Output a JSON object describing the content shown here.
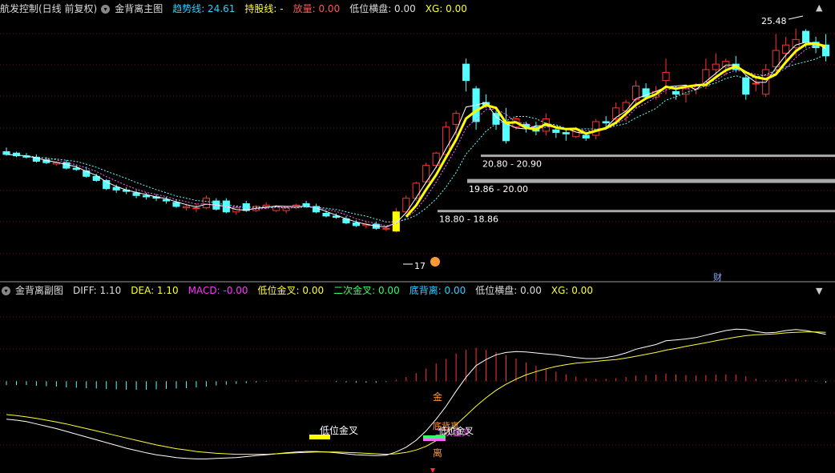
{
  "main_header": {
    "control_label": "航发控制(日线 前复权)",
    "indicator_name": "金背离主图",
    "items": [
      {
        "label": "趋势线: 24.61",
        "color": "#33ccff"
      },
      {
        "label": "持股线: -",
        "color": "#ffff33"
      },
      {
        "label": "放量: 0.00",
        "color": "#ff5555"
      },
      {
        "label": "低位横盘: 0.00",
        "color": "#dddddd"
      },
      {
        "label": "XG: 0.00",
        "color": "#ffff33"
      }
    ]
  },
  "sub_header": {
    "indicator_name": "金背离副图",
    "items": [
      {
        "label": "DIFF: 1.10",
        "color": "#dddddd"
      },
      {
        "label": "DEA: 1.10",
        "color": "#ffff33"
      },
      {
        "label": "MACD: -0.00",
        "color": "#ff33ff"
      },
      {
        "label": "低位金叉: 0.00",
        "color": "#ffff33"
      },
      {
        "label": "二次金叉: 0.00",
        "color": "#33ff66"
      },
      {
        "label": "底背离: 0.00",
        "color": "#33ccff"
      },
      {
        "label": "低位横盘: 0.00",
        "color": "#dddddd"
      },
      {
        "label": "XG: 0.00",
        "color": "#ffff33"
      }
    ]
  },
  "corner_icons": {
    "up": "▲",
    "down": "▼"
  },
  "annotations": {
    "high_label": "25.48",
    "low_label": "17",
    "cai_label": "财",
    "zones": [
      {
        "label": "20.80 - 20.90",
        "price": 20.85
      },
      {
        "label": "19.86 - 20.00",
        "price": 19.93
      },
      {
        "label": "18.80 - 18.86",
        "price": 18.83
      }
    ],
    "sub_labels": {
      "golden_cross": "低位金叉",
      "jin": "金",
      "stacked_a": "底背离",
      "stacked_b": "二次金叉",
      "stacked_c": "低位金叉",
      "li": "离"
    }
  },
  "colors": {
    "up": "#ff3333",
    "down": "#54ffff",
    "trend": "#ffff00",
    "ma": "#ffffff",
    "grid": "#6b1414",
    "diff": "#ffffff",
    "dea": "#ffff33"
  },
  "chart_data": {
    "type": "candlestick",
    "price_range": [
      16.6,
      25.9
    ],
    "candles": [
      [
        21.0,
        21.15,
        20.85,
        20.9
      ],
      [
        20.95,
        21.0,
        20.8,
        20.85
      ],
      [
        20.85,
        20.95,
        20.75,
        20.8
      ],
      [
        20.8,
        20.9,
        20.6,
        20.65
      ],
      [
        20.7,
        20.8,
        20.55,
        20.6
      ],
      [
        20.55,
        20.65,
        20.5,
        20.6
      ],
      [
        20.6,
        20.7,
        20.35,
        20.4
      ],
      [
        20.4,
        20.5,
        20.3,
        20.35
      ],
      [
        20.3,
        20.45,
        20.05,
        20.1
      ],
      [
        20.1,
        20.2,
        19.9,
        19.95
      ],
      [
        19.95,
        20.0,
        19.6,
        19.65
      ],
      [
        19.7,
        19.8,
        19.5,
        19.6
      ],
      [
        19.6,
        19.7,
        19.45,
        19.55
      ],
      [
        19.5,
        19.6,
        19.3,
        19.4
      ],
      [
        19.4,
        19.5,
        19.25,
        19.35
      ],
      [
        19.35,
        19.45,
        19.2,
        19.3
      ],
      [
        19.25,
        19.35,
        19.1,
        19.2
      ],
      [
        19.15,
        19.25,
        18.95,
        19.0
      ],
      [
        18.95,
        19.1,
        18.85,
        19.0
      ],
      [
        18.95,
        19.1,
        18.8,
        18.95
      ],
      [
        18.95,
        19.4,
        18.9,
        19.3
      ],
      [
        19.2,
        19.3,
        18.85,
        18.9
      ],
      [
        19.2,
        19.3,
        18.75,
        18.8
      ],
      [
        18.8,
        18.95,
        18.7,
        18.95
      ],
      [
        19.1,
        19.2,
        18.8,
        18.85
      ],
      [
        18.85,
        19.05,
        18.8,
        19.0
      ],
      [
        19.0,
        19.15,
        18.9,
        19.05
      ],
      [
        18.85,
        19.05,
        18.8,
        19.0
      ],
      [
        18.85,
        19.0,
        18.75,
        18.95
      ],
      [
        18.95,
        19.1,
        18.9,
        19.05
      ],
      [
        19.1,
        19.2,
        18.95,
        19.0
      ],
      [
        19.0,
        19.1,
        18.75,
        18.8
      ],
      [
        18.75,
        18.85,
        18.6,
        18.65
      ],
      [
        18.65,
        18.75,
        18.55,
        18.6
      ],
      [
        18.55,
        18.65,
        18.35,
        18.4
      ],
      [
        18.4,
        18.5,
        18.25,
        18.3
      ],
      [
        18.3,
        18.45,
        18.2,
        18.35
      ],
      [
        18.35,
        18.45,
        18.15,
        18.2
      ],
      [
        18.2,
        18.3,
        18.1,
        18.2
      ],
      [
        18.1,
        18.95,
        18.05,
        18.8
      ],
      [
        18.8,
        19.4,
        18.75,
        19.3
      ],
      [
        19.3,
        19.9,
        19.2,
        19.85
      ],
      [
        19.9,
        20.6,
        19.85,
        20.5
      ],
      [
        20.5,
        21.0,
        20.4,
        20.95
      ],
      [
        20.9,
        22.1,
        20.8,
        21.9
      ],
      [
        22.0,
        22.5,
        21.6,
        22.4
      ],
      [
        24.2,
        24.4,
        23.2,
        23.6
      ],
      [
        23.3,
        23.4,
        21.8,
        22.1
      ],
      [
        22.8,
        23.1,
        22.6,
        22.7
      ],
      [
        22.4,
        22.5,
        21.8,
        22.0
      ],
      [
        22.1,
        22.6,
        21.3,
        21.4
      ],
      [
        21.9,
        22.3,
        21.8,
        22.2
      ],
      [
        22.0,
        22.1,
        21.7,
        21.9
      ],
      [
        21.9,
        22.1,
        21.6,
        21.75
      ],
      [
        21.75,
        22.4,
        21.6,
        22.2
      ],
      [
        21.8,
        21.9,
        21.5,
        21.7
      ],
      [
        21.7,
        21.8,
        21.4,
        21.65
      ],
      [
        21.55,
        21.9,
        21.5,
        21.8
      ],
      [
        21.6,
        21.7,
        21.4,
        21.5
      ],
      [
        21.6,
        22.2,
        21.45,
        22.1
      ],
      [
        22.1,
        22.3,
        21.8,
        22.05
      ],
      [
        22.2,
        22.8,
        22.0,
        22.6
      ],
      [
        22.5,
        22.9,
        22.1,
        22.8
      ],
      [
        22.9,
        23.6,
        22.6,
        23.4
      ],
      [
        23.3,
        23.5,
        22.9,
        23.0
      ],
      [
        23.0,
        23.4,
        22.9,
        23.2
      ],
      [
        23.6,
        24.4,
        23.1,
        23.9
      ],
      [
        23.2,
        23.4,
        22.9,
        23.1
      ],
      [
        23.1,
        23.4,
        22.8,
        23.3
      ],
      [
        23.3,
        23.5,
        23.1,
        23.4
      ],
      [
        23.4,
        24.4,
        23.3,
        24.0
      ],
      [
        24.0,
        24.6,
        23.8,
        24.2
      ],
      [
        24.1,
        24.4,
        23.8,
        24.3
      ],
      [
        24.2,
        24.5,
        23.9,
        24.0
      ],
      [
        23.7,
        23.8,
        22.9,
        23.1
      ],
      [
        23.5,
        23.7,
        23.2,
        23.5
      ],
      [
        23.1,
        24.2,
        23.0,
        24.0
      ],
      [
        24.1,
        25.3,
        23.9,
        24.7
      ],
      [
        24.6,
        25.2,
        24.3,
        24.9
      ],
      [
        24.8,
        25.5,
        24.5,
        25.1
      ],
      [
        25.4,
        25.48,
        24.8,
        25.0
      ],
      [
        25.0,
        25.2,
        24.6,
        24.8
      ],
      [
        24.9,
        25.3,
        24.3,
        24.5
      ]
    ],
    "macd": {
      "diff": [
        -0.3,
        -0.32,
        -0.35,
        -0.4,
        -0.45,
        -0.5,
        -0.56,
        -0.62,
        -0.68,
        -0.74,
        -0.8,
        -0.86,
        -0.92,
        -0.97,
        -1.02,
        -1.06,
        -1.09,
        -1.12,
        -1.14,
        -1.15,
        -1.15,
        -1.14,
        -1.13,
        -1.12,
        -1.1,
        -1.08,
        -1.06,
        -1.04,
        -1.02,
        -1.0,
        -0.99,
        -0.99,
        -1.0,
        -1.02,
        -1.04,
        -1.06,
        -1.07,
        -1.08,
        -1.07,
        -1.0,
        -0.9,
        -0.75,
        -0.55,
        -0.3,
        -0.02,
        0.3,
        0.6,
        0.85,
        0.98,
        1.08,
        1.13,
        1.15,
        1.14,
        1.12,
        1.1,
        1.08,
        1.05,
        1.02,
        1.0,
        1.0,
        1.02,
        1.06,
        1.12,
        1.2,
        1.25,
        1.3,
        1.38,
        1.4,
        1.42,
        1.45,
        1.5,
        1.55,
        1.6,
        1.63,
        1.62,
        1.58,
        1.55,
        1.56,
        1.6,
        1.62,
        1.6,
        1.56,
        1.52
      ],
      "dea": [
        -0.2,
        -0.22,
        -0.25,
        -0.28,
        -0.32,
        -0.36,
        -0.4,
        -0.45,
        -0.5,
        -0.55,
        -0.6,
        -0.65,
        -0.7,
        -0.75,
        -0.8,
        -0.85,
        -0.89,
        -0.93,
        -0.96,
        -0.99,
        -1.01,
        -1.03,
        -1.04,
        -1.05,
        -1.05,
        -1.05,
        -1.05,
        -1.04,
        -1.03,
        -1.02,
        -1.01,
        -1.0,
        -1.0,
        -1.0,
        -1.01,
        -1.02,
        -1.03,
        -1.04,
        -1.05,
        -1.04,
        -1.01,
        -0.96,
        -0.88,
        -0.76,
        -0.6,
        -0.42,
        -0.22,
        -0.02,
        0.16,
        0.32,
        0.45,
        0.56,
        0.65,
        0.72,
        0.78,
        0.83,
        0.87,
        0.9,
        0.92,
        0.94,
        0.96,
        0.98,
        1.01,
        1.05,
        1.09,
        1.13,
        1.18,
        1.22,
        1.26,
        1.3,
        1.34,
        1.38,
        1.42,
        1.46,
        1.49,
        1.51,
        1.52,
        1.53,
        1.55,
        1.56,
        1.57,
        1.57,
        1.56
      ]
    }
  }
}
